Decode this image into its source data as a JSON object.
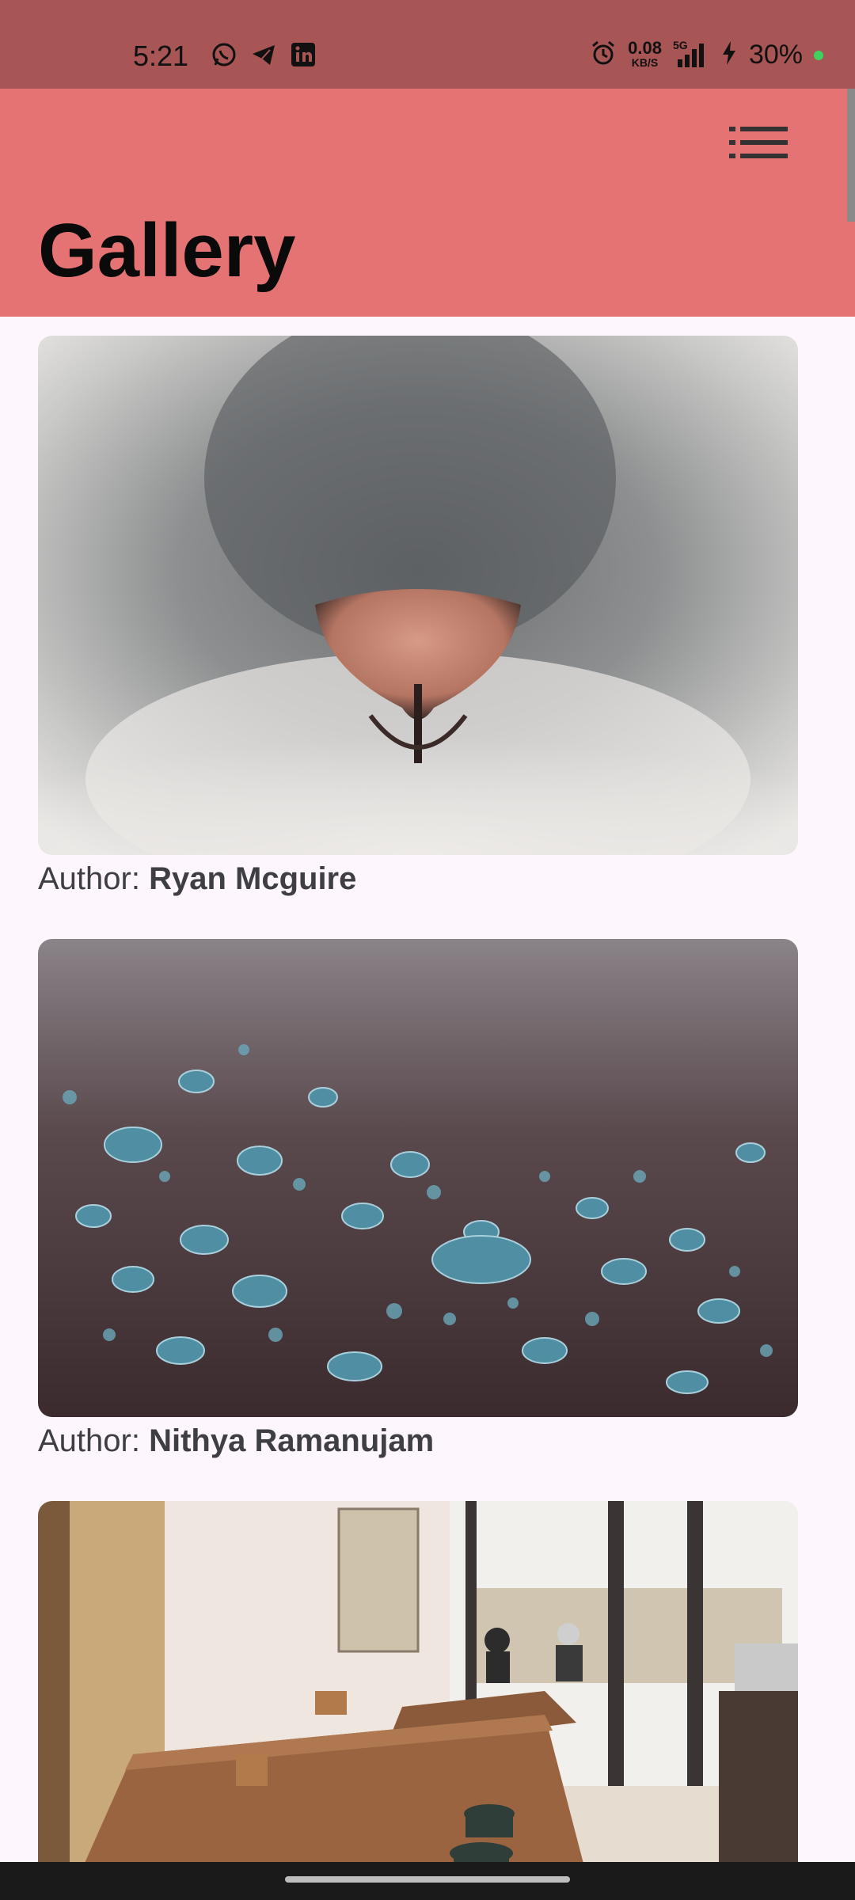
{
  "status_bar": {
    "time": "5:21",
    "net_speed_value": "0.08",
    "net_speed_unit": "KB/S",
    "network_type": "5G",
    "battery": "30%"
  },
  "header": {
    "title": "Gallery",
    "menu_icon": "list-icon"
  },
  "gallery": {
    "items": [
      {
        "author_prefix": "Author: ",
        "author_name": "Ryan Mcguire",
        "image": "cat-nose-closeup"
      },
      {
        "author_prefix": "Author: ",
        "author_name": "Nithya Ramanujam",
        "image": "water-droplets"
      },
      {
        "image": "cafe-interior"
      }
    ]
  },
  "colors": {
    "status_bar": "#A85555",
    "app_bar": "#E57373",
    "background": "#FDF7FD"
  }
}
